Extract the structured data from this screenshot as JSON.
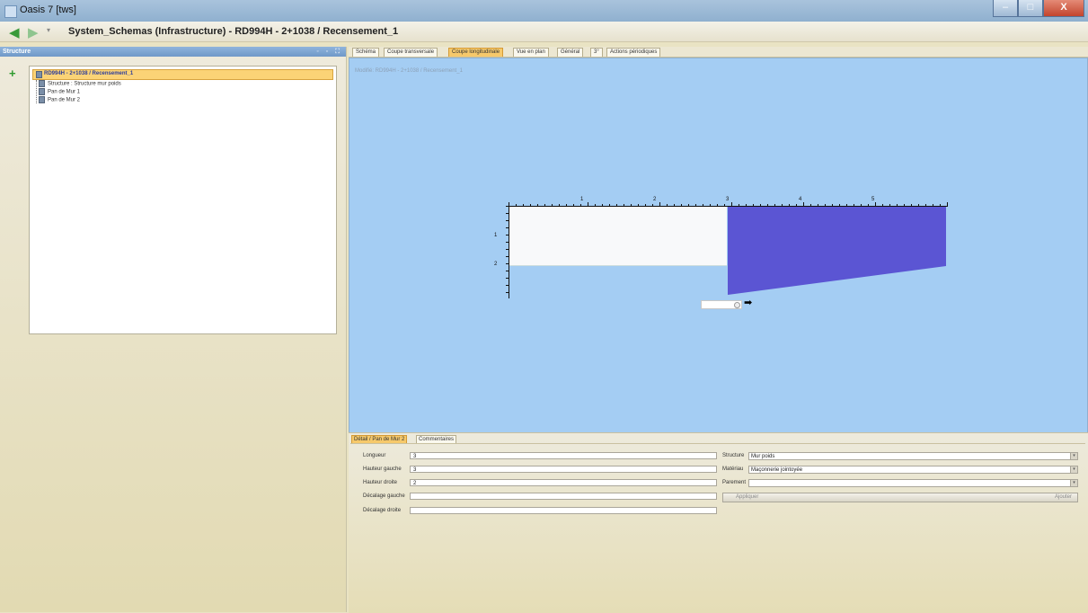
{
  "window": {
    "title": "Oasis 7 [tws]",
    "minimize": "–",
    "maximize": "□",
    "close": "X"
  },
  "nav": {
    "back_icon": "arrow-left-icon",
    "forward_icon": "arrow-right-icon",
    "breadcrumb": "System_Schemas (Infrastructure) - RD994H - 2+1038 / Recensement_1"
  },
  "structure_panel": {
    "title": "Structure",
    "tools": "◦ ▫ ⛶",
    "add_icon": "+",
    "tree": {
      "root": "RD994H - 2+1038 / Recensement_1",
      "children": [
        "Structure : Structure mur poids",
        "Pan de Mur 1",
        "Pan de Mur 2"
      ]
    }
  },
  "tabs": [
    "Schéma",
    "Coupe transversale",
    "Coupe longitudinale",
    "Vue en plan",
    "Général",
    "3°",
    "Actions périodiques"
  ],
  "active_tab": "Coupe longitudinale",
  "canvas": {
    "caption": "Modifié: RD994H - 2+1038 / Recensement_1",
    "background": "#a4cdf3",
    "wall_color": "#5b55d3",
    "ruler_x_labels": [
      "1",
      "2",
      "3",
      "4",
      "5"
    ],
    "ruler_y_labels": [
      "1",
      "2"
    ]
  },
  "detail": {
    "tabs": [
      "Détail / Pan de Mur 2",
      "Commentaires"
    ],
    "fields_left": [
      {
        "label": "Longueur",
        "value": "3"
      },
      {
        "label": "Hauteur gauche",
        "value": "3"
      },
      {
        "label": "Hauteur droite",
        "value": "2"
      },
      {
        "label": "Décalage gauche",
        "value": ""
      },
      {
        "label": "Décalage droite",
        "value": ""
      }
    ],
    "fields_right": [
      {
        "label": "Structure",
        "value": "Mur poids"
      },
      {
        "label": "Matériau",
        "value": "Maçonnerie jointoyée"
      },
      {
        "label": "Parement",
        "value": ""
      }
    ],
    "button_left": "Appliquer",
    "button_right": "Ajouter"
  }
}
